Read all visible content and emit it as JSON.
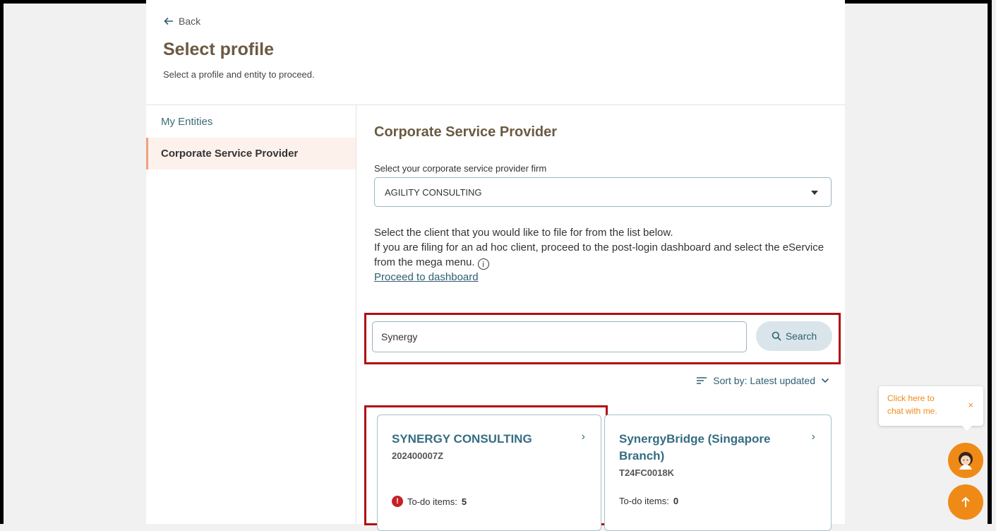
{
  "header": {
    "back_label": "Back",
    "title": "Select profile",
    "subtitle": "Select a profile and entity to proceed."
  },
  "sidebar": {
    "items": [
      {
        "label": "My Entities",
        "active": false
      },
      {
        "label": "Corporate Service Provider",
        "active": true
      }
    ]
  },
  "main": {
    "section_title": "Corporate Service Provider",
    "select_label": "Select your corporate service provider firm",
    "select_value": "AGILITY CONSULTING",
    "desc_line1": "Select the client that you would like to file for from the list below.",
    "desc_line2": "If you are filing for an ad hoc client, proceed to the post-login dashboard and select the eService from the mega menu.",
    "proceed_link": "Proceed to dashboard",
    "search": {
      "value": "Synergy",
      "button_label": "Search"
    },
    "sort_label": "Sort by: Latest updated",
    "entities": [
      {
        "name": "SYNERGY CONSULTING",
        "id": "202400007Z",
        "todo_label": "To-do items:",
        "todo_count": "5",
        "alert": true
      },
      {
        "name": "SynergyBridge (Singapore Branch)",
        "id": "T24FC0018K",
        "todo_label": "To-do items:",
        "todo_count": "0",
        "alert": false
      }
    ]
  },
  "chat": {
    "bubble_text": "Click here to chat with me.",
    "close_label": "×"
  },
  "colors": {
    "accent": "#f08a17",
    "highlight": "#b10f12",
    "title_brown": "#6b5a43",
    "link_teal": "#2f5f72"
  }
}
